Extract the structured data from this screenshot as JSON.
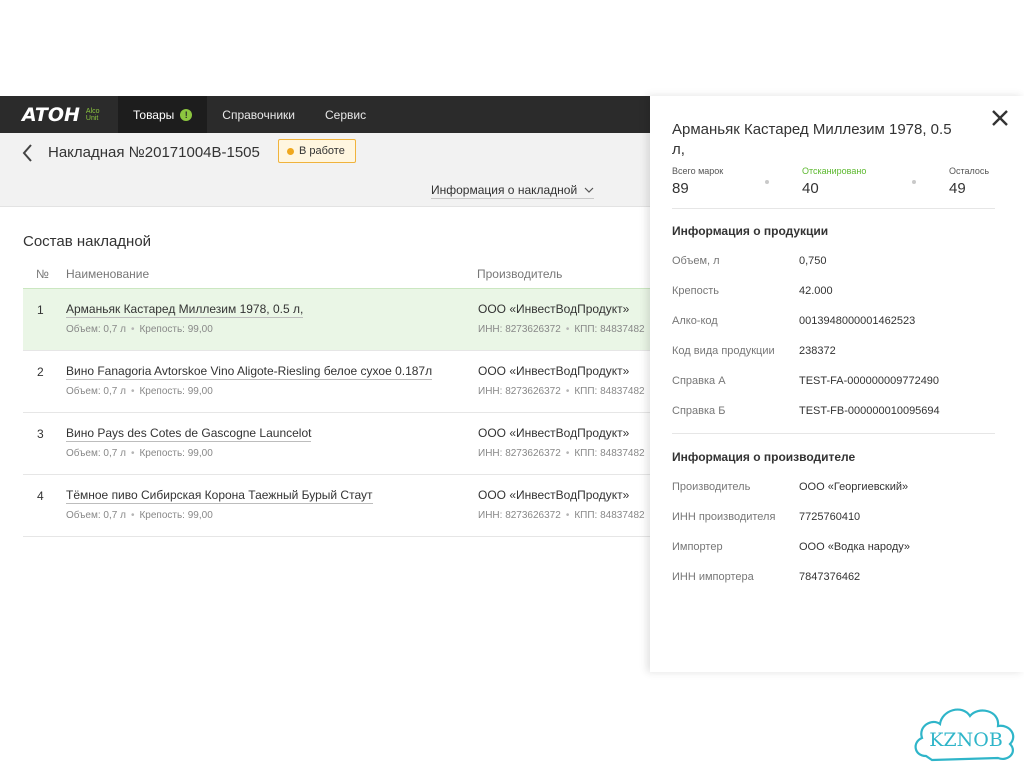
{
  "topbar": {
    "logo": {
      "word": "ATOH",
      "sub_line1": "Alco",
      "sub_line2": "Unit"
    },
    "nav": [
      {
        "label": "Товары",
        "badge": "!"
      },
      {
        "label": "Справочники"
      },
      {
        "label": "Сервис"
      }
    ]
  },
  "header": {
    "title": "Накладная №20171004B-1505",
    "status": "В работе",
    "info_toggle": "Информация о накладной"
  },
  "list": {
    "title": "Состав накладной",
    "columns": {
      "num": "№",
      "name": "Наименование",
      "maker": "Производитель"
    },
    "rows": [
      {
        "num": "1",
        "name": "Арманьяк Кастаред Миллезим 1978, 0.5 л,",
        "volume": "Объем: 0,7 л",
        "strength": "Крепость: 99,00",
        "maker": "ООО «ИнвестВодПродукт»",
        "inn": "ИНН: 8273626372",
        "kpp": "КПП: 84837482"
      },
      {
        "num": "2",
        "name": "Вино Fanagoria Avtorskoe Vino Aligote-Riesling белое сухое 0.187л",
        "volume": "Объем: 0,7 л",
        "strength": "Крепость: 99,00",
        "maker": "ООО «ИнвестВодПродукт»",
        "inn": "ИНН: 8273626372",
        "kpp": "КПП: 84837482"
      },
      {
        "num": "3",
        "name": "Вино Pays des Cotes de Gascogne Launcelot",
        "volume": "Объем: 0,7 л",
        "strength": "Крепость: 99,00",
        "maker": "ООО «ИнвестВодПродукт»",
        "inn": "ИНН: 8273626372",
        "kpp": "КПП: 84837482"
      },
      {
        "num": "4",
        "name": "Тёмное пиво Сибирская Корона Таежный Бурый Стаут",
        "volume": "Объем: 0,7 л",
        "strength": "Крепость: 99,00",
        "maker": "ООО «ИнвестВодПродукт»",
        "inn": "ИНН: 8273626372",
        "kpp": "КПП: 84837482"
      }
    ]
  },
  "panel": {
    "title": "Арманьяк Кастаред Миллезим 1978, 0.5 л,",
    "stats": {
      "total_label": "Всего марок",
      "total": "89",
      "scanned_label": "Отсканировано",
      "scanned": "40",
      "left_label": "Осталось",
      "left": "49"
    },
    "product_section": "Информация о продукции",
    "product": [
      {
        "label": "Объем, л",
        "value": "0,750"
      },
      {
        "label": "Крепость",
        "value": "42.000"
      },
      {
        "label": "Алко-код",
        "value": "0013948000001462523"
      },
      {
        "label": "Код вида продукции",
        "value": "238372"
      },
      {
        "label": "Справка А",
        "value": "TEST-FA-000000009772490"
      },
      {
        "label": "Справка Б",
        "value": "TEST-FB-000000010095694"
      }
    ],
    "maker_section": "Информация о производителе",
    "maker": [
      {
        "label": "Производитель",
        "value": "ООО «Георгиевский»"
      },
      {
        "label": "ИНН производителя",
        "value": "7725760410"
      },
      {
        "label": "Импортер",
        "value": "ООО «Водка народу»"
      },
      {
        "label": "ИНН импортера",
        "value": "7847376462"
      }
    ]
  },
  "watermark": {
    "text": "KZNOB"
  },
  "colors": {
    "accent_green": "#8cc63f",
    "status_orange": "#f0a81e",
    "topbar": "#2b2b2b"
  }
}
